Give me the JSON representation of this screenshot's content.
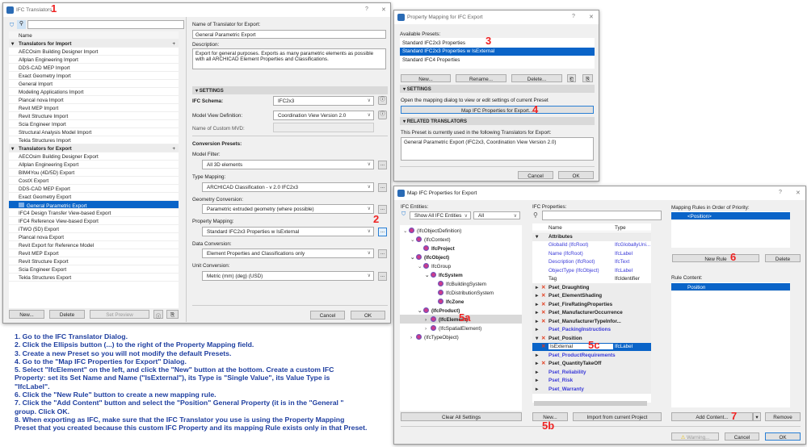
{
  "translators": {
    "title": "IFC Translators",
    "col_name": "Name",
    "import_group": "Translators for Import",
    "import_items": [
      "AECOsim Building Designer Import",
      "Allplan Engineering Import",
      "DDS-CAD MEP Import",
      "Exact Geometry Import",
      "General Import",
      "Modeling Applications Import",
      "Plancal nova Import",
      "Revit MEP Import",
      "Revit Structure Import",
      "Scia Engineer Import",
      "Structural Analysis Model Import",
      "Tekla Structures Import"
    ],
    "export_group": "Translators for Export",
    "export_items": [
      "AECOsim Building Designer Export",
      "Allplan Engineering Export",
      "BIM4You (4D/5D) Export",
      "CostX Export",
      "DDS-CAD MEP Export",
      "Exact Geometry Export",
      "General Parametric Export",
      "IFC4 Design Transfer View-based Export",
      "IFC4 Reference View-based Export",
      "iTWO (5D) Export",
      "Plancal nova Export",
      "Revit Export for Reference Model",
      "Revit MEP Export",
      "Revit Structure Export",
      "Scia Engineer Export",
      "Tekla Structures Export"
    ],
    "selected_export": "General Parametric Export",
    "buttons": {
      "new": "New...",
      "delete": "Delete",
      "set_preview": "Set Preview"
    },
    "name_label": "Name of Translator for Export:",
    "name_value": "General Parametric Export",
    "desc_label": "Description:",
    "desc_value": "Export for general purposes. Exports as many parametric elements as possible with all ARCHICAD Element Properties and Classifications.",
    "settings_header": "SETTINGS",
    "schema_label": "IFC Schema:",
    "schema_value": "IFC2x3",
    "mvd_label": "Model View Definition:",
    "mvd_value": "Coordination View Version 2.0",
    "custom_mvd_label": "Name of Custom MVD:",
    "conv_label": "Conversion Presets:",
    "model_filter_label": "Model Filter:",
    "model_filter_value": "All 3D elements",
    "type_mapping_label": "Type Mapping:",
    "type_mapping_value": "ARCHICAD Classification - v 2.0 IFC2x3",
    "geometry_label": "Geometry Conversion:",
    "geometry_value": "Parametric extruded geometry (where possible)",
    "property_mapping_label": "Property Mapping:",
    "property_mapping_value": "Standard IFC2x3 Properties w IsExternal",
    "data_conv_label": "Data Conversion:",
    "data_conv_value": "Element Properties and Classifications only",
    "unit_label": "Unit Conversion:",
    "unit_value": "Metric (mm) (deg) (USD)",
    "cancel": "Cancel",
    "ok": "OK"
  },
  "mapping": {
    "title": "Property Mapping for IFC Export",
    "presets_label": "Available Presets:",
    "presets": [
      "Standard IFC2x3 Properties",
      "Standard IFC2x3 Properties w IsExternal",
      "Standard IFC4 Properties"
    ],
    "new": "New...",
    "rename": "Rename...",
    "delete": "Delete...",
    "settings_header": "SETTINGS",
    "settings_text": "Open the mapping dialog to view or edit settings of current Preset",
    "map_button": "Map IFC Properties for Export...",
    "related_header": "RELATED TRANSLATORS",
    "related_text": "This Preset is currently used in the following Translators for Export:",
    "related_value": "General Parametric Export (IFC2x3, Coordination View Version 2.0)",
    "cancel": "Cancel",
    "ok": "OK"
  },
  "mapprops": {
    "title": "Map IFC Properties for Export",
    "entities_label": "IFC Entities:",
    "filter1": "Show All IFC Entities",
    "filter2": "All",
    "tree": [
      {
        "t": "(IfcObjectDefinition)",
        "l": 0,
        "e": "v"
      },
      {
        "t": "(IfcContext)",
        "l": 1,
        "e": "v"
      },
      {
        "t": "IfcProject",
        "l": 2,
        "e": "",
        "b": true
      },
      {
        "t": "(IfcObject)",
        "l": 1,
        "e": "v",
        "b": true
      },
      {
        "t": "IfcGroup",
        "l": 2,
        "e": "v"
      },
      {
        "t": "IfcSystem",
        "l": 3,
        "e": "v",
        "b": true
      },
      {
        "t": "IfcBuildingSystem",
        "l": 4,
        "e": ""
      },
      {
        "t": "IfcDistributionSystem",
        "l": 4,
        "e": ""
      },
      {
        "t": "IfcZone",
        "l": 4,
        "e": "",
        "b": true
      },
      {
        "t": "(IfcProduct)",
        "l": 2,
        "e": "v",
        "b": true
      },
      {
        "t": "(IfcElement)",
        "l": 3,
        "e": ">",
        "b": true,
        "sel": true
      },
      {
        "t": "(IfcSpatialElement)",
        "l": 3,
        "e": ">"
      },
      {
        "t": "(IfcTypeObject)",
        "l": 1,
        "e": ">"
      }
    ],
    "clear": "Clear All Settings",
    "props_label": "IFC Properties:",
    "col_name": "Name",
    "col_type": "Type",
    "props": [
      {
        "n": "Attributes",
        "k": "grp"
      },
      {
        "n": "GlobalId (IfcRoot)",
        "t": "IfcGloballyUni...",
        "k": "attr"
      },
      {
        "n": "Name (IfcRoot)",
        "t": "IfcLabel",
        "k": "attr"
      },
      {
        "n": "Description (IfcRoot)",
        "t": "IfcText",
        "k": "attr"
      },
      {
        "n": "ObjectType (IfcObject)",
        "t": "IfcLabel",
        "k": "attr"
      },
      {
        "n": "Tag",
        "t": "IfcIdentifier",
        "k": "plain"
      },
      {
        "n": "Pset_Draughting",
        "k": "pset"
      },
      {
        "n": "Pset_ElementShading",
        "k": "pset"
      },
      {
        "n": "Pset_FireRatingProperties",
        "k": "pset"
      },
      {
        "n": "Pset_ManufacturerOccurrence",
        "k": "pset"
      },
      {
        "n": "Pset_ManufacturerTypeInfor...",
        "k": "pset"
      },
      {
        "n": "Pset_PackingInstructions",
        "k": "bpset"
      },
      {
        "n": "Pset_Position",
        "k": "pset",
        "open": true
      },
      {
        "n": "IsExternal",
        "t": "IfcLabel",
        "k": "edit"
      },
      {
        "n": "Pset_ProductRequirements",
        "k": "bpset"
      },
      {
        "n": "Pset_QuantityTakeOff",
        "k": "pset"
      },
      {
        "n": "Pset_Reliability",
        "k": "bpset"
      },
      {
        "n": "Pset_Risk",
        "k": "bpset"
      },
      {
        "n": "Pset_Warranty",
        "k": "bpset"
      }
    ],
    "new": "New...",
    "import": "Import from current Project",
    "rules_label": "Mapping Rules in Order of Priority:",
    "rule": "<Position>",
    "new_rule": "New Rule",
    "delete": "Delete",
    "content_label": "Rule Content:",
    "content": "Position",
    "add_content": "Add Content...",
    "remove": "Remove",
    "warning": "Warning...",
    "cancel": "Cancel",
    "ok": "OK"
  },
  "annotations": [
    "1",
    "2",
    "3",
    "4",
    "5a",
    "5b",
    "5c",
    "6",
    "7"
  ],
  "instructions": [
    "1. Go to the IFC Translator Dialog.",
    "2. Click the Ellipsis button (...) to the right of the Property Mapping field.",
    "3. Create a new Preset so you will not modify the default Presets.",
    "4. Go to the \"Map IFC Properties for Export\" Dialog.",
    "5. Select \"IfcElement\" on the left, and click the \"New\" button at the bottom. Create a custom IFC",
    "Property: set its Set Name and Name (\"IsExternal\"), its Type is \"Single Value\", its Value Type is",
    "\"IfcLabel\".",
    "6. Click the \"New Rule\" button to create a new mapping rule.",
    "7. Click the \"Add Content\" button and select the \"Position\" General Property (it is in the \"General \"",
    "group. Click OK.",
    "8. When exporting as IFC, make sure that the IFC Translator you use is using the Property Mapping",
    "Preset that you created because this custom IFC Property and its mapping Rule exists only in that Preset."
  ]
}
